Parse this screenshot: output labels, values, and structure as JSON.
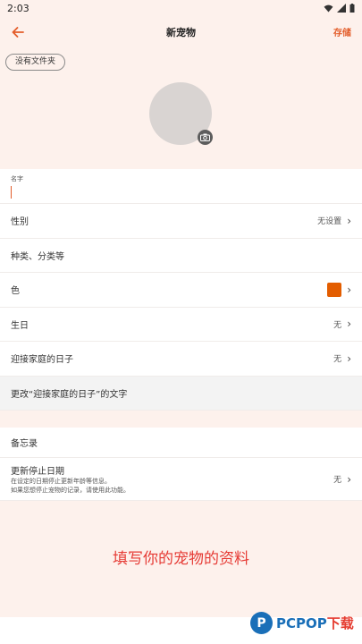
{
  "status_bar": {
    "time": "2:03"
  },
  "app_bar": {
    "title": "新宠物",
    "save_label": "存储"
  },
  "folder_chip": {
    "label": "没有文件夹"
  },
  "form": {
    "name_label": "名字",
    "gender": {
      "label": "性别",
      "value": "无设置"
    },
    "species_placeholder": "种类、分类等",
    "color": {
      "label": "色",
      "swatch": "#e35d00"
    },
    "birthday": {
      "label": "生日",
      "value": "无"
    },
    "welcome_day": {
      "label": "迎接家庭的日子",
      "value": "无"
    },
    "change_welcome_text": "更改“迎接家庭的日子”的文字",
    "memo_label": "备忘录",
    "stop_update": {
      "title": "更新停止日期",
      "desc1": "在设定的日期停止更新年龄等信息。",
      "desc2": "如果您想停止宠物的记录，请使用此功能。",
      "value": "无"
    }
  },
  "caption": "填写你的宠物的资料",
  "watermark": {
    "brand": "PCPOP",
    "suffix": "下载"
  },
  "colors": {
    "accent": "#e35d2a",
    "background": "#fdf1ec"
  }
}
